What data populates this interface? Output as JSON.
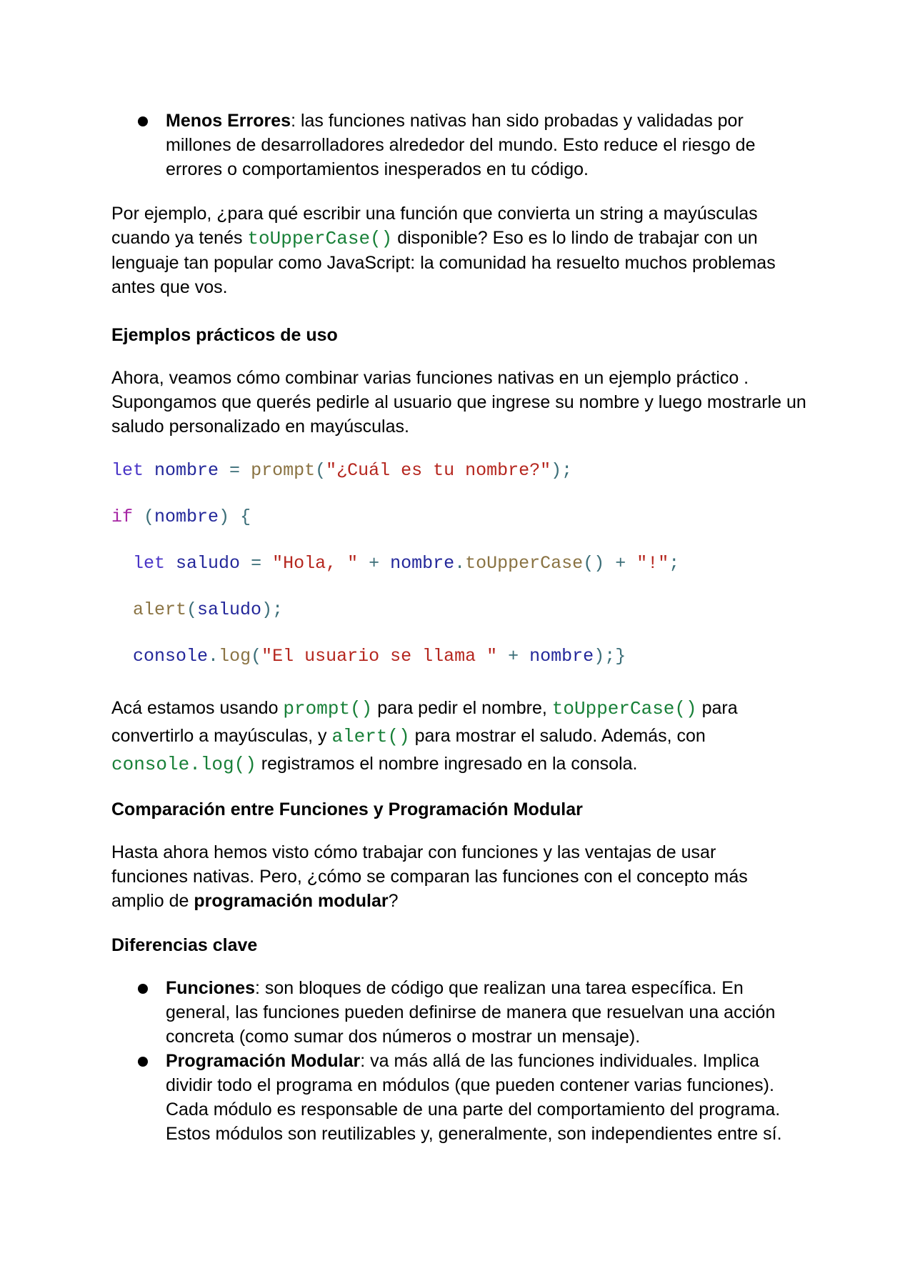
{
  "bullet_top": {
    "term": "Menos Errores",
    "text": ": las funciones nativas han sido probadas y validadas por millones de desarrolladores alrededor del mundo. Esto reduce el riesgo de errores o comportamientos inesperados en tu código."
  },
  "para1": {
    "before": "Por ejemplo, ¿para qué escribir una función que convierta un string a mayúsculas cuando ya tenés ",
    "code": "toUpperCase()",
    "after": " disponible? Eso es lo lindo de trabajar con un lenguaje tan popular como JavaScript: la comunidad ha resuelto muchos problemas antes que vos."
  },
  "heading1": "Ejemplos prácticos de uso",
  "para2": "Ahora, veamos cómo combinar varias funciones nativas en un ejemplo práctico . Supongamos que querés pedirle al usuario que ingrese su nombre y luego mostrarle un saludo personalizado en mayúsculas.",
  "code_lines": [
    "let nombre = prompt(\"¿Cuál es tu nombre?\");",
    "if (nombre) {",
    "  let saludo = \"Hola, \" + nombre.toUpperCase() + \"!\";",
    "  alert(saludo);",
    "  console.log(\"El usuario se llama \" + nombre);}"
  ],
  "code_tokens": {
    "let": "let",
    "nombre": "nombre",
    "eq": " = ",
    "prompt": "prompt",
    "str_prompt": "\"¿Cuál es tu nombre?\"",
    "if": "if",
    "saludo": "saludo",
    "str_hola": "\"Hola, \"",
    "plus": " + ",
    "toUpperCase": "toUpperCase",
    "str_excl": "\"!\"",
    "alert": "alert",
    "console": "console",
    "log": "log",
    "str_usuario": "\"El usuario se llama \""
  },
  "para3": {
    "t1": "Acá estamos usando ",
    "c1": "prompt()",
    "t2": " para pedir el nombre, ",
    "c2": "toUpperCase()",
    "t3": " para convertirlo a mayúsculas, y ",
    "c3": "alert()",
    "t4": " para mostrar el saludo. Además, con ",
    "c4": "console.log()",
    "t5": " registramos el nombre ingresado en la consola."
  },
  "heading2": "Comparación entre Funciones y Programación Modular",
  "para4": {
    "before": "Hasta ahora hemos visto cómo trabajar con funciones y las ventajas de usar funciones nativas. Pero, ¿cómo se comparan las funciones con el concepto más amplio de ",
    "bold": "programación modular",
    "after": "?"
  },
  "heading3": "Diferencias clave",
  "bullets": [
    {
      "term": "Funciones",
      "text": ": son bloques de código que realizan una tarea específica. En general, las funciones pueden definirse de manera que resuelvan una acción concreta (como sumar dos números o mostrar un mensaje)."
    },
    {
      "term": "Programación Modular",
      "text": ": va más allá de las funciones individuales. Implica dividir todo el programa en módulos (que pueden contener varias funciones). Cada módulo es responsable de una parte del comportamiento del programa. Estos módulos son reutilizables y, generalmente, son independientes entre sí."
    }
  ]
}
